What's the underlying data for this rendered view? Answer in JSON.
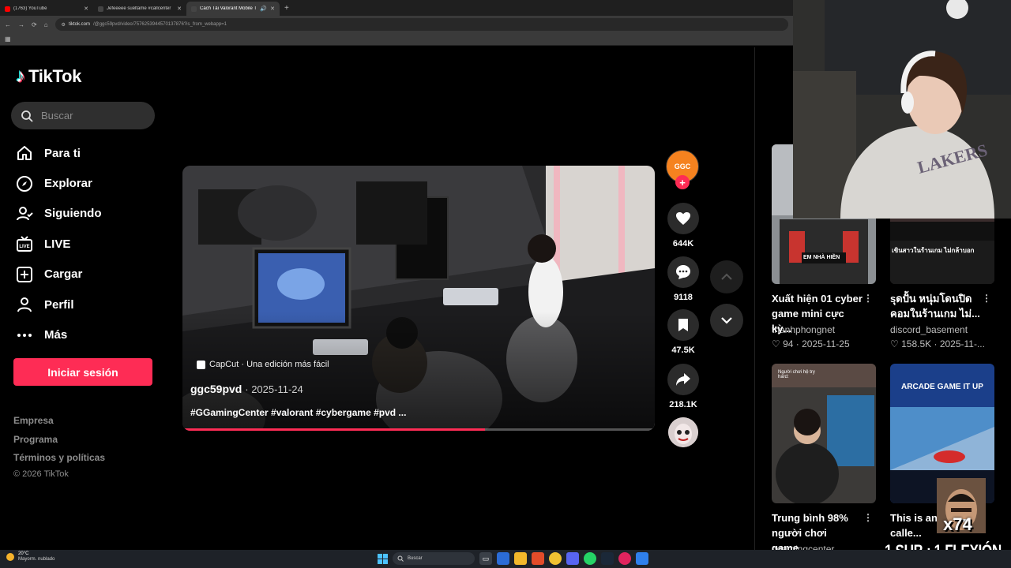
{
  "browser": {
    "tabs": [
      {
        "title": "(1763) YouTube",
        "active": false,
        "color": "#ff0000"
      },
      {
        "title": "Jefeeeee suéltame #callcenter",
        "active": false,
        "color": "#111111"
      },
      {
        "title": "Cách Tải Valorant Mobile T",
        "active": true,
        "color": "#111111"
      }
    ],
    "new_tab": "+",
    "url": {
      "host": "tiktok.com",
      "path": "/@ggc59pvd/video/7576253944570137876?is_from_webapp=1"
    }
  },
  "tiktok": {
    "logo_text": "TikTok",
    "search_placeholder": "Buscar",
    "menu": [
      {
        "label": "Para ti",
        "icon": "home-icon"
      },
      {
        "label": "Explorar",
        "icon": "compass-icon"
      },
      {
        "label": "Siguiendo",
        "icon": "following-icon"
      },
      {
        "label": "LIVE",
        "icon": "live-tv-icon"
      },
      {
        "label": "Cargar",
        "icon": "upload-icon"
      },
      {
        "label": "Perfil",
        "icon": "profile-icon"
      },
      {
        "label": "Más",
        "icon": "more-icon"
      }
    ],
    "login_button": "Iniciar sesión",
    "footer": [
      "Empresa",
      "Programa",
      "Términos y políticas"
    ],
    "copyright": "© 2026 TikTok"
  },
  "video": {
    "capcut_label": "CapCut · Una edición más fácil",
    "author": "ggc59pvd",
    "date": "2025-11-24",
    "caption": "#GGamingCenter #valorant #cybergame #pvd ...",
    "progress": 0.64,
    "avatar_text": "GGC",
    "likes": "644K",
    "comments": "9118",
    "saves": "47.5K",
    "shares": "218.1K"
  },
  "related": [
    {
      "title": "Xuất hiện 01 cyber game mini cực kỳ...",
      "author": "thanhphongnet",
      "likes": "94",
      "date": "2025-11-25",
      "overlay": "EM NHÀ HIỀN"
    },
    {
      "title": "sุดปั้น หนุ่มโดนปิดคอมในร้านเกม ไม่...",
      "author": "discord_basement",
      "likes": "158.5K",
      "date": "2025-11-...",
      "overlay": "เขินสาวในร้านเกม ไม่กล้าบอก"
    },
    {
      "title": "Trung bình 98% người chơi game...",
      "author": "ggamingcenter",
      "likes": "",
      "date": "",
      "overlay": "Người chơi hệ try hard:"
    },
    {
      "title": "This is an centre calle...",
      "author": "",
      "likes": "",
      "date": "",
      "overlay": "ARCADE GAME IT UP"
    }
  ],
  "stream": {
    "counter": "x74",
    "subtext": "1 SUB : 1 FLEXIÓN"
  },
  "taskbar": {
    "temp": "20°C",
    "weather": "Mayorm. nublado",
    "search": "Buscar"
  },
  "colors": {
    "accent": "#fe2c55",
    "bg": "#000000"
  }
}
